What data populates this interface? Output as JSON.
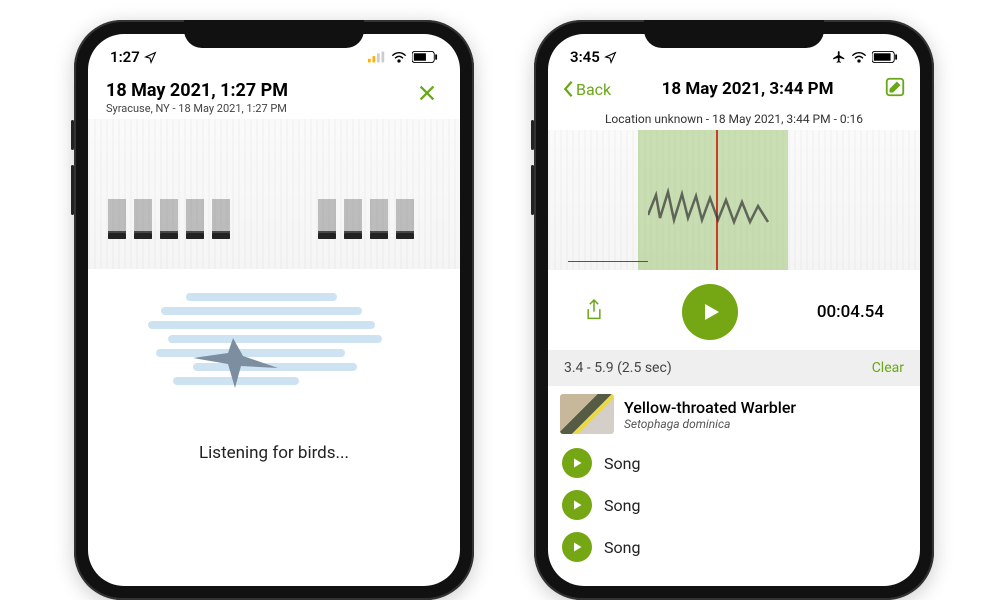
{
  "phone1": {
    "status": {
      "time": "1:27"
    },
    "header": {
      "title": "18 May 2021, 1:27 PM",
      "subtitle": "Syracuse, NY - 18 May 2021, 1:27 PM"
    },
    "listening_text": "Listening for birds..."
  },
  "phone2": {
    "status": {
      "time": "3:45"
    },
    "nav": {
      "back_label": "Back",
      "title": "18 May 2021, 3:44 PM"
    },
    "meta": "Location unknown - 18 May 2021, 3:44 PM - 0:16",
    "timecode": "00:04.54",
    "selection": {
      "info": "3.4 - 5.9 (2.5 sec)",
      "clear_label": "Clear"
    },
    "species": {
      "common": "Yellow-throated Warbler",
      "scientific": "Setophaga dominica"
    },
    "songs": [
      "Song",
      "Song",
      "Song"
    ]
  },
  "colors": {
    "accent": "#6aa718",
    "play": "#74a713"
  }
}
